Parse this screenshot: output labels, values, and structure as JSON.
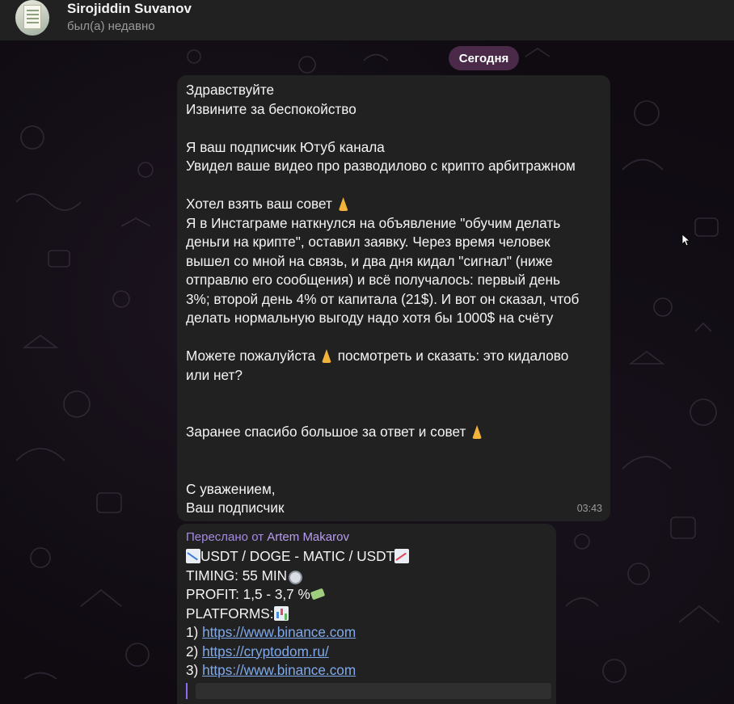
{
  "header": {
    "contact_name": "Sirojiddin Suvanov",
    "status": "был(а) недавно"
  },
  "date_pill": "Сегодня",
  "message1": {
    "lines": [
      "Здравствуйте",
      "Извините за беспокойство",
      "",
      "Я ваш подписчик Ютуб канала",
      "Увидел ваше видео про разводилово с крипто арбитражном",
      "",
      "Хотел взять ваш совет",
      "Я в Инстаграме наткнулся на объявление \"обучим делать",
      "деньги на крипте\", оставил заявку. Через время человек",
      "вышел со мной на связь, и два дня кидал \"сигнал\" (ниже",
      "отправлю его сообщения) и всё получалось: первый день",
      "3%; второй день 4% от капитала (21$). И вот он сказал, чтоб",
      "делать нормальную выгоду надо хотя бы 1000$ на счёту",
      "",
      "Можете пожалуйста",
      "посмотреть и сказать: это кидалово",
      "или нет?",
      "",
      "",
      "Заранее спасибо большое за ответ и совет",
      "",
      "",
      "С уважением,",
      "Ваш подписчик"
    ],
    "time": "03:43"
  },
  "message2": {
    "forwarded_prefix": "Переслано от",
    "forwarded_from": "Artem Makarov",
    "pair": "USDT / DOGE - MATIC / USDT",
    "timing": "TIMING: 55 MIN",
    "profit": "PROFIT: 1,5 - 3,7 %",
    "platforms": "PLATFORMS:",
    "links": [
      {
        "num": "1)",
        "url": "https://www.binance.com"
      },
      {
        "num": "2)",
        "url": "https://cryptodom.ru/"
      },
      {
        "num": "3)",
        "url": "https://www.binance.com"
      }
    ]
  },
  "icons": {
    "pray": "folded-hands-emoji",
    "chart_down": "chart-decreasing-emoji",
    "chart_up": "chart-increasing-emoji",
    "timer": "stopwatch-emoji",
    "money": "money-with-wings-emoji",
    "bars": "bar-chart-emoji"
  },
  "colors": {
    "header_bg": "#212121",
    "bubble_bg": "#212121",
    "date_pill_bg": "#4a2a48",
    "link": "#7fa9ea",
    "forward_name": "#a58be0"
  }
}
